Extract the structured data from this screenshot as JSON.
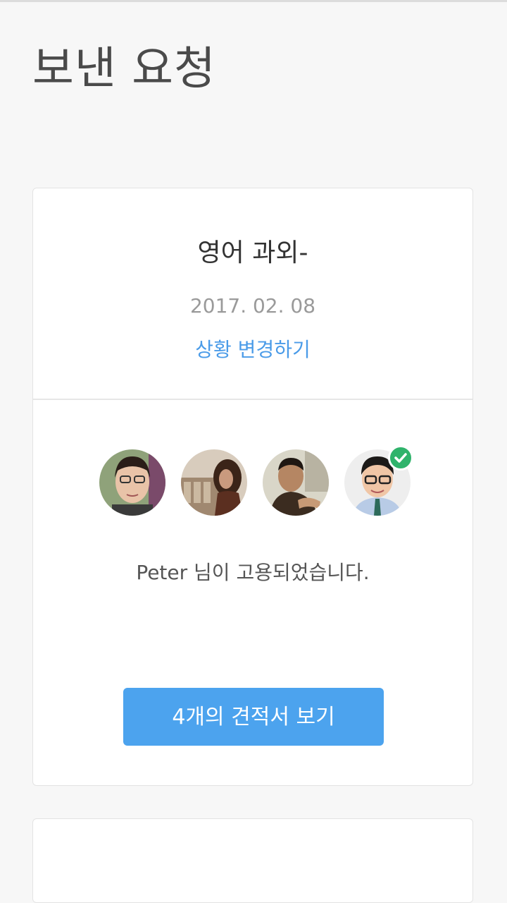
{
  "header": {
    "title": "보낸 요청"
  },
  "request_card": {
    "title": "영어 과외-",
    "date": "2017. 02. 08",
    "status_link": "상황 변경하기",
    "avatars": [
      {
        "name": "applicant-1",
        "hired": false
      },
      {
        "name": "applicant-2",
        "hired": false
      },
      {
        "name": "applicant-3",
        "hired": false
      },
      {
        "name": "applicant-4",
        "hired": true
      }
    ],
    "hired_message": "Peter 님이 고용되었습니다.",
    "quotes_button": "4개의 견적서 보기"
  },
  "next_card": {
    "title": ""
  },
  "colors": {
    "accent": "#4ca3ee",
    "link": "#4a9be8",
    "hired_badge": "#2fb36b",
    "background": "#f7f7f7"
  },
  "icons": {
    "hired_badge": "check-icon"
  }
}
